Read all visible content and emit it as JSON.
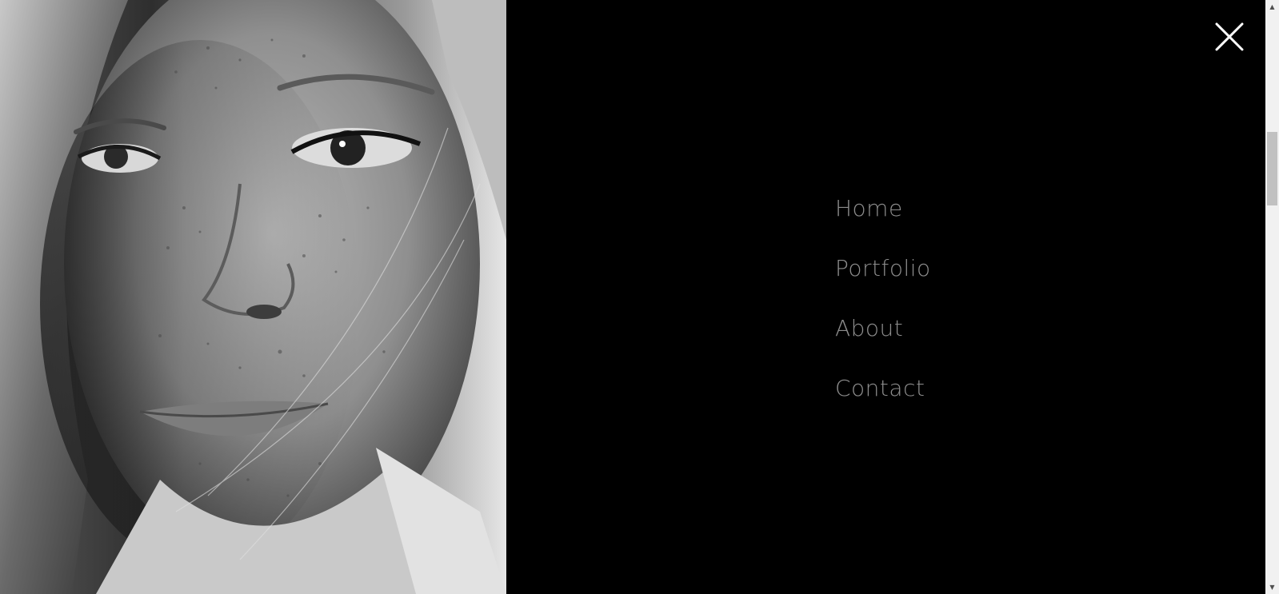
{
  "photo": {
    "alt_icon": "portrait-photo"
  },
  "menu": {
    "close_icon": "close-icon",
    "items": [
      {
        "label": "Home"
      },
      {
        "label": "Portfolio"
      },
      {
        "label": "About"
      },
      {
        "label": "Contact"
      }
    ]
  },
  "scrollbar": {
    "up_glyph": "▲",
    "down_glyph": "▼"
  },
  "colors": {
    "background": "#000000",
    "nav_text": "#8d8d8d",
    "close_icon": "#ffffff"
  }
}
